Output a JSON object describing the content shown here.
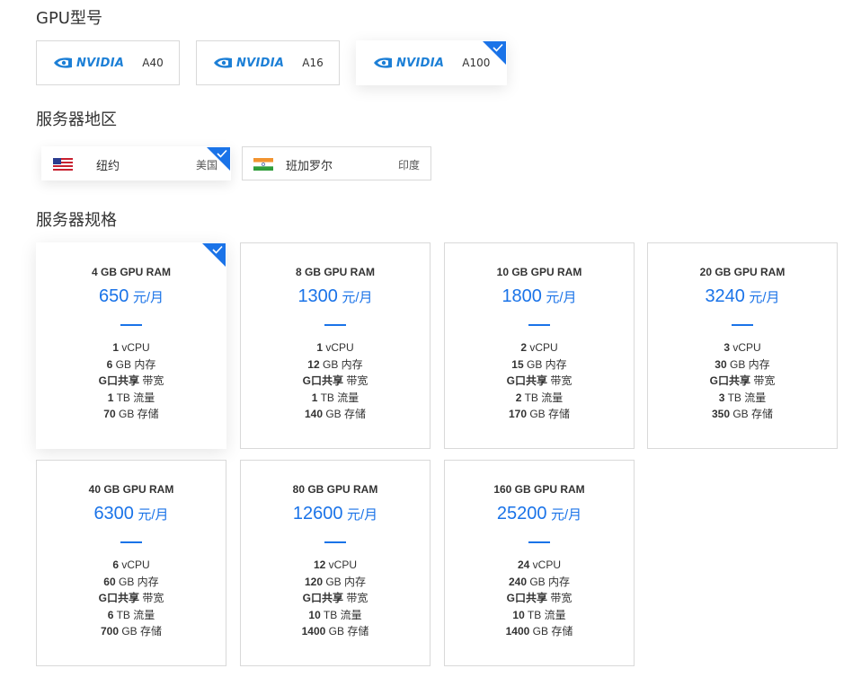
{
  "sections": {
    "gpu_model": "GPU型号",
    "region": "服务器地区",
    "spec": "服务器规格"
  },
  "gpus": [
    {
      "brand": "NVIDIA",
      "model": "A40",
      "selected": false
    },
    {
      "brand": "NVIDIA",
      "model": "A16",
      "selected": false
    },
    {
      "brand": "NVIDIA",
      "model": "A100",
      "selected": true
    }
  ],
  "regions": [
    {
      "city": "纽约",
      "country": "美国",
      "flag": "us-flag-icon",
      "selected": true
    },
    {
      "city": "班加罗尔",
      "country": "印度",
      "flag": "india-flag-icon",
      "selected": false
    }
  ],
  "plans": [
    {
      "ram": "4 GB GPU RAM",
      "price": "650",
      "unit": "元/月",
      "vcpu": "1",
      "mem": "6",
      "bandwidth": "G口共享",
      "traffic": "1",
      "storage": "70",
      "selected": true
    },
    {
      "ram": "8 GB GPU RAM",
      "price": "1300",
      "unit": "元/月",
      "vcpu": "1",
      "mem": "12",
      "bandwidth": "G口共享",
      "traffic": "1",
      "storage": "140",
      "selected": false
    },
    {
      "ram": "10 GB GPU RAM",
      "price": "1800",
      "unit": "元/月",
      "vcpu": "2",
      "mem": "15",
      "bandwidth": "G口共享",
      "traffic": "2",
      "storage": "170",
      "selected": false
    },
    {
      "ram": "20 GB GPU RAM",
      "price": "3240",
      "unit": "元/月",
      "vcpu": "3",
      "mem": "30",
      "bandwidth": "G口共享",
      "traffic": "3",
      "storage": "350",
      "selected": false
    },
    {
      "ram": "40 GB GPU RAM",
      "price": "6300",
      "unit": "元/月",
      "vcpu": "6",
      "mem": "60",
      "bandwidth": "G口共享",
      "traffic": "6",
      "storage": "700",
      "selected": false
    },
    {
      "ram": "80 GB GPU RAM",
      "price": "12600",
      "unit": "元/月",
      "vcpu": "12",
      "mem": "120",
      "bandwidth": "G口共享",
      "traffic": "10",
      "storage": "1400",
      "selected": false
    },
    {
      "ram": "160 GB GPU RAM",
      "price": "25200",
      "unit": "元/月",
      "vcpu": "24",
      "mem": "240",
      "bandwidth": "G口共享",
      "traffic": "10",
      "storage": "1400",
      "selected": false
    }
  ],
  "spec_labels": {
    "vcpu": "vCPU",
    "mem": "GB 内存",
    "bandwidth": "带宽",
    "traffic": "TB 流量",
    "storage": "GB 存储"
  },
  "colors": {
    "accent": "#1a73e8",
    "nvidia_blue": "#1c7fd6",
    "border": "#d9d9d9"
  }
}
